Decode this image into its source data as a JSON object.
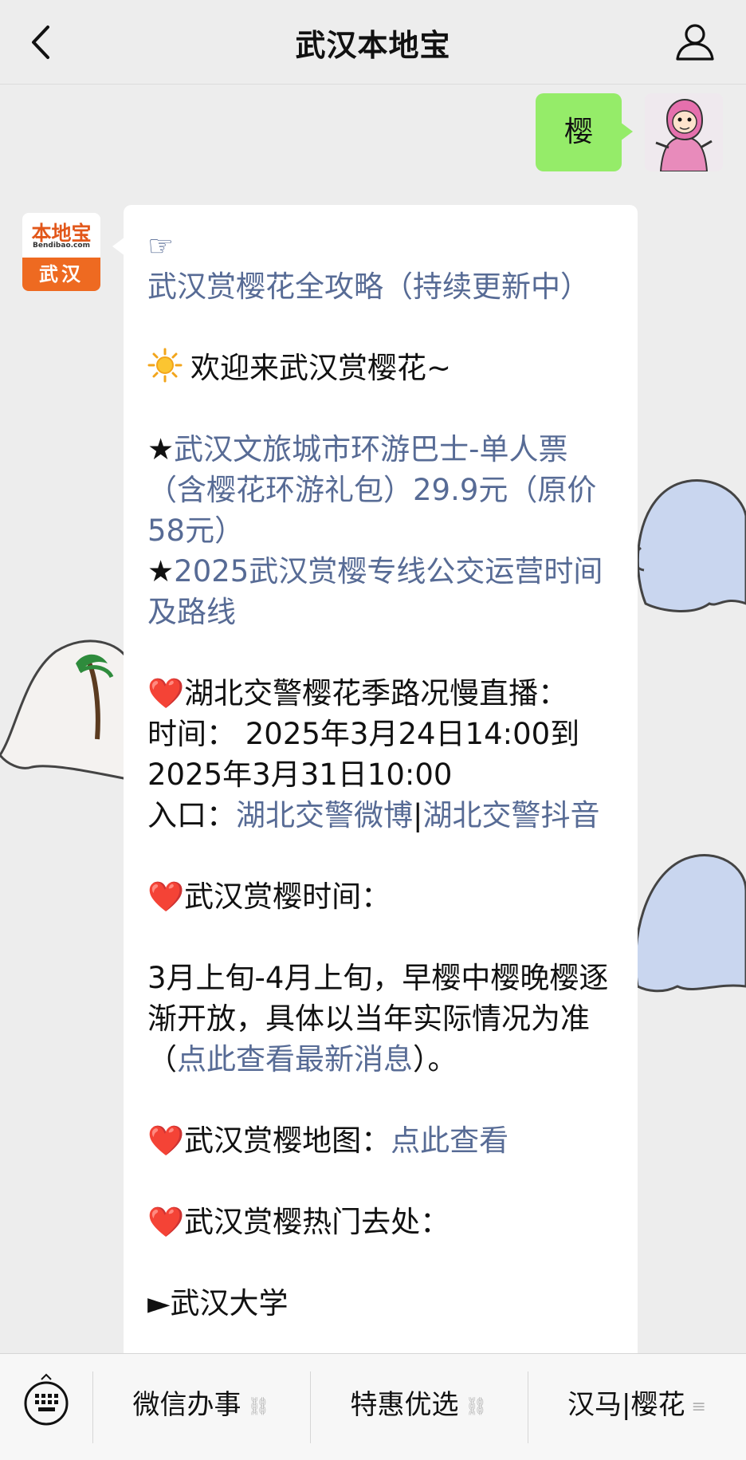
{
  "header": {
    "title": "武汉本地宝",
    "back_icon": "chevron-left-icon",
    "profile_icon": "person-icon"
  },
  "user_message": {
    "text": "樱"
  },
  "bot_avatar": {
    "brand": "本地宝",
    "brand_sub": "Bendibao.com",
    "city": "武汉"
  },
  "bot_message": {
    "line_guide_prefix": "☞",
    "guide_link": "武汉赏樱花全攻略（持续更新中）",
    "welcome": "欢迎来武汉赏樱花~",
    "star1_prefix": "★",
    "star1_link": "武汉文旅城市环游巴士-单人票（含樱花环游礼包）29.9元",
    "star1_note": "（原价 58元）",
    "star2_prefix": "★",
    "star2_link": "2025武汉赏樱专线公交运营时间及路线",
    "traffic_heading": "湖北交警樱花季路况慢直播：",
    "traffic_time": "时间：  2025年3月24日14:00到2025年3月31日10:00",
    "traffic_entry_label": "入口：",
    "traffic_link1": "湖北交警微博",
    "traffic_sep": "|",
    "traffic_link2": "湖北交警抖音",
    "time_heading": "武汉赏樱时间：",
    "time_body": "3月上旬-4月上旬，早樱中樱晚樱逐渐开放，具体以当年实际情况为准（",
    "time_link": "点此查看最新消息",
    "time_tail": "）。",
    "map_heading": "武汉赏樱地图：",
    "map_link": "点此查看",
    "hot_heading": "武汉赏樱热门去处：",
    "hot_first_prefix": "►",
    "hot_first": "武汉大学",
    "colors": {
      "link": "#576b95",
      "bubble_user": "#95ec69",
      "heart": "#e0242c"
    }
  },
  "menu": {
    "keyboard_icon": "keyboard-icon",
    "items": [
      {
        "label": "微信办事",
        "icon": "link-icon"
      },
      {
        "label": "特惠优选",
        "icon": "link-icon"
      },
      {
        "label": "汉马|樱花",
        "icon": "menu-lines-icon"
      }
    ]
  }
}
